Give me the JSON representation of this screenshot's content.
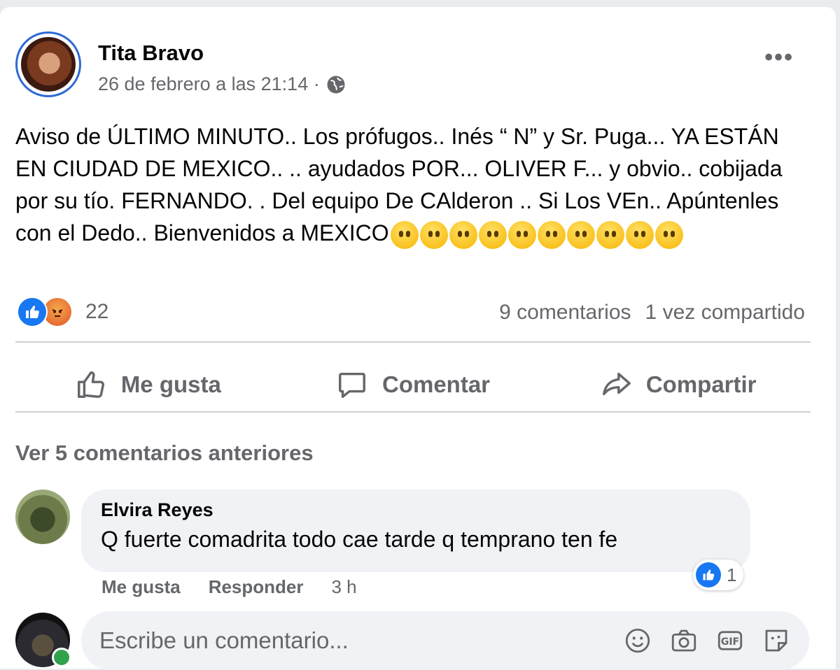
{
  "post": {
    "author": "Tita Bravo",
    "timestamp": "26 de febrero a las 21:14 ·",
    "audience_icon": "globe-icon",
    "text": "Aviso de ÚLTIMO MINUTO.. Los prófugos.. Inés “ N” y Sr. Puga... YA ESTÁN EN CIUDAD DE MEXICO.. .. ayudados POR... OLIVER F... y obvio.. cobijada por su tío. FERNANDO. . Del equipo De CAlderon .. Si Los VEn.. Apúntenles con el Dedo.. Bienvenidos a MEXICO",
    "emoji_count": 10,
    "more_label": "•••"
  },
  "reactions": {
    "count": "22",
    "comments": "9 comentarios",
    "shares": "1 vez compartido"
  },
  "actions": {
    "like": "Me gusta",
    "comment": "Comentar",
    "share": "Compartir"
  },
  "comments": {
    "previous": "Ver 5 comentarios anteriores",
    "items": [
      {
        "name": "Elvira Reyes",
        "text": "Q fuerte comadrita todo cae tarde q temprano ten fe",
        "reaction_count": "1",
        "like": "Me gusta",
        "reply": "Responder",
        "time": "3 h"
      }
    ]
  },
  "composer": {
    "placeholder": "Escribe un comentario..."
  },
  "colors": {
    "accent": "#1877f2",
    "muted": "#65676b",
    "bubble": "#f0f2f5",
    "online": "#31a24c"
  }
}
